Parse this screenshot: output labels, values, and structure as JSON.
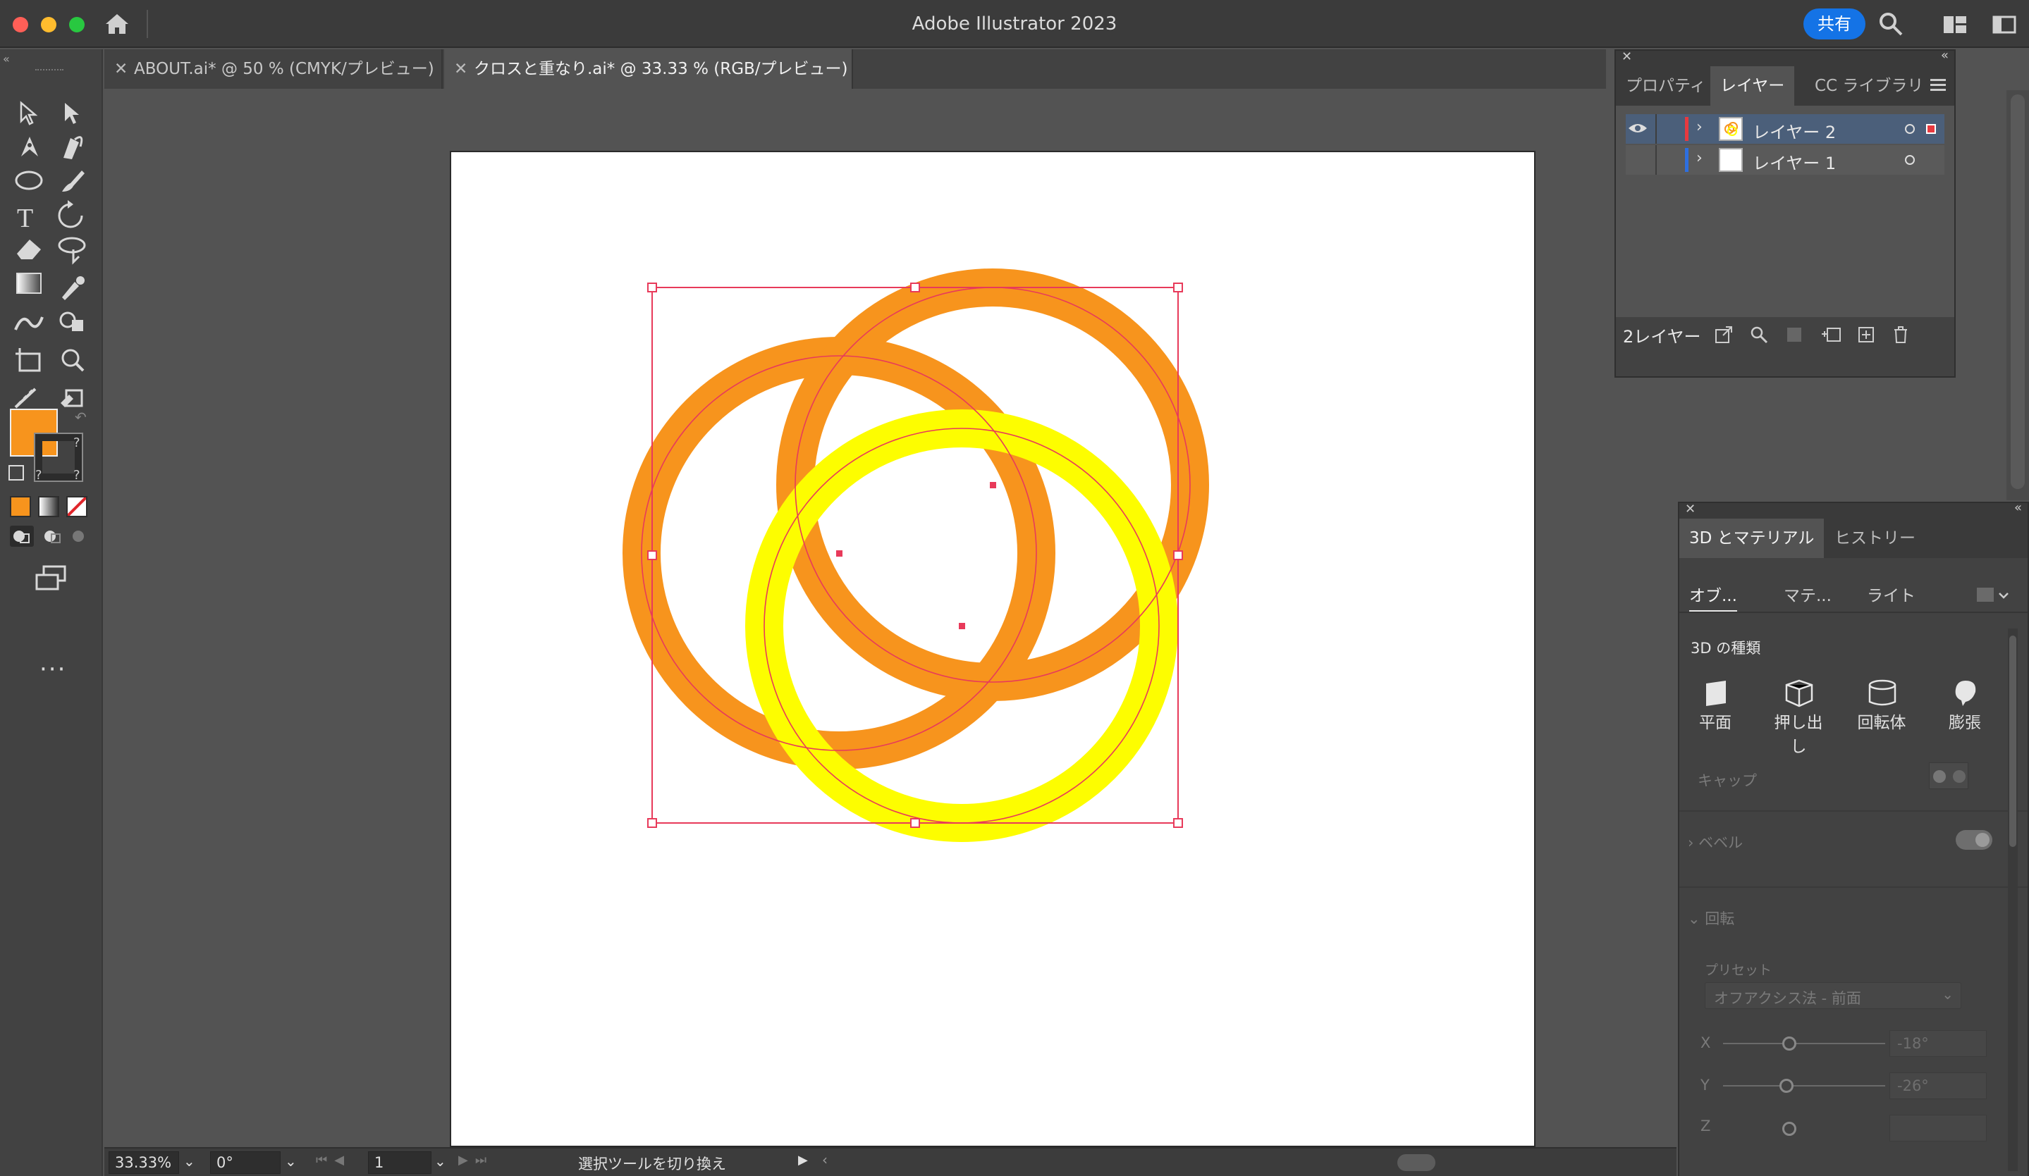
{
  "window": {
    "title": "Adobe Illustrator 2023",
    "share_label": "共有"
  },
  "tabs": [
    {
      "label": "ABOUT.ai* @ 50 % (CMYK/プレビュー)",
      "active": false
    },
    {
      "label": "クロスと重なり.ai* @ 33.33 % (RGB/プレビュー)",
      "active": true
    }
  ],
  "tools": [
    "selection-tool",
    "direct-selection-tool",
    "pen-tool",
    "curvature-tool",
    "ellipse-tool",
    "paintbrush-tool",
    "type-tool",
    "rotate-tool",
    "eraser-tool",
    "lasso-tool",
    "gradient-tool",
    "eyedropper-tool",
    "width-tool",
    "shape-builder-tool",
    "artboard-tool",
    "zoom-tool",
    "puppet-warp-tool",
    "live-paint-tool"
  ],
  "colors": {
    "fill": "#f7941d",
    "ring_orange": "#f7941d",
    "ring_yellow": "#fdfd00",
    "selection": "#e83a5a",
    "ui_bg": "#535353",
    "accent": "#1473e6"
  },
  "layers_panel": {
    "tabs": [
      "プロパティ",
      "レイヤー",
      "CC ライブラリ"
    ],
    "active_tab": "レイヤー",
    "layers": [
      {
        "name": "レイヤー 2",
        "color": "#e8393f",
        "visible": true,
        "selected": true
      },
      {
        "name": "レイヤー 1",
        "color": "#2d6fe0",
        "visible": false,
        "selected": false
      }
    ],
    "footer_count": "2レイヤー"
  },
  "panel_3d": {
    "tabs": [
      "3D とマテリアル",
      "ヒストリー"
    ],
    "subtabs": [
      "オブ...",
      "マテ...",
      "ライト"
    ],
    "type_heading": "3D の種類",
    "types": [
      "平面",
      "押し出し",
      "回転体",
      "膨張"
    ],
    "cap_label": "キャップ",
    "bevel_label": "ベベル",
    "rotation_label": "回転",
    "preset_label": "プリセット",
    "preset_value": "オフアクシス法 - 前面",
    "x_label": "X",
    "x_value": "-18°",
    "y_label": "Y",
    "y_value": "-26°",
    "z_label": "Z"
  },
  "status": {
    "zoom": "33.33%",
    "rotation": "0°",
    "artboard": "1",
    "message": "選択ツールを切り換え"
  }
}
